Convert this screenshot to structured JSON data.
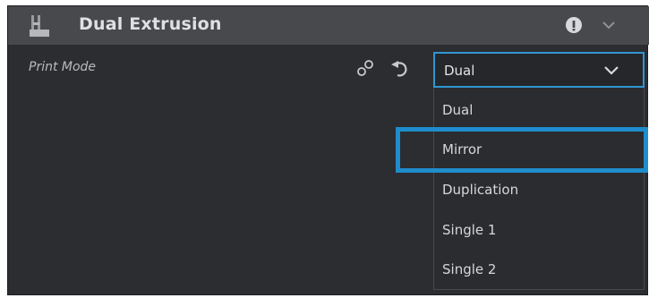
{
  "section": {
    "title": "Dual Extrusion"
  },
  "setting": {
    "label": "Print Mode",
    "selected_value": "Dual",
    "options": [
      {
        "label": "Dual"
      },
      {
        "label": "Mirror"
      },
      {
        "label": "Duplication"
      },
      {
        "label": "Single 1"
      },
      {
        "label": "Single 2"
      }
    ],
    "highlighted_option": "Mirror"
  },
  "icons": {
    "section_icon": "flask-icon",
    "info": "info-icon",
    "collapse": "chevron-down-icon",
    "link": "link-icon",
    "reset": "reset-icon",
    "dropdown_chevron": "chevron-down-icon"
  },
  "colors": {
    "panel_bg": "#2b2d30",
    "header_bg": "#47494c",
    "accent": "#3196d3",
    "highlight_border": "#1f8ccc",
    "text": "#dfe0e1"
  }
}
